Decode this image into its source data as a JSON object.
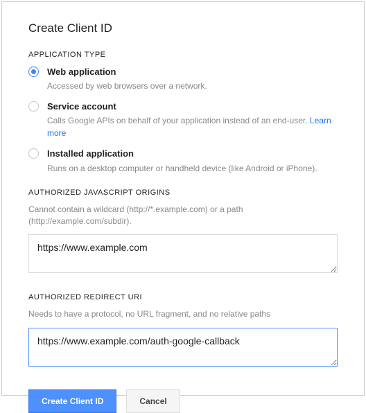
{
  "title": "Create Client ID",
  "appTypeLabel": "APPLICATION TYPE",
  "options": [
    {
      "label": "Web application",
      "desc": "Accessed by web browsers over a network.",
      "selected": true,
      "learnMore": false
    },
    {
      "label": "Service account",
      "desc": "Calls Google APIs on behalf of your application instead of an end-user. ",
      "selected": false,
      "learnMore": true,
      "learnMoreLabel": "Learn more"
    },
    {
      "label": "Installed application",
      "desc": "Runs on a desktop computer or handheld device (like Android or iPhone).",
      "selected": false,
      "learnMore": false
    }
  ],
  "jsOrigins": {
    "label": "AUTHORIZED JAVASCRIPT ORIGINS",
    "desc": "Cannot contain a wildcard (http://*.example.com) or a path (http://example.com/subdir).",
    "value": "https://www.example.com"
  },
  "redirectUri": {
    "label": "AUTHORIZED REDIRECT URI",
    "desc": "Needs to have a protocol, no URL fragment, and no relative paths",
    "value": "https://www.example.com/auth-google-callback"
  },
  "buttons": {
    "create": "Create Client ID",
    "cancel": "Cancel"
  }
}
